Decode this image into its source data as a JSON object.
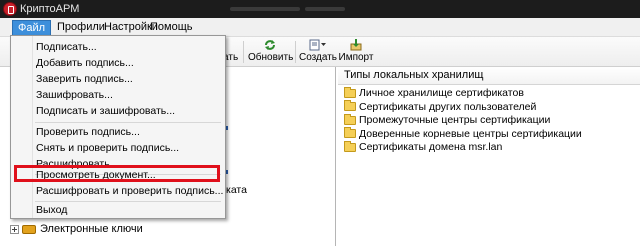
{
  "window": {
    "title": "КриптоАРМ"
  },
  "menubar": {
    "items": [
      {
        "label": "Файл",
        "active": true
      },
      {
        "label": "Профили",
        "active": false
      },
      {
        "label": "Настройки",
        "active": false
      },
      {
        "label": "Помощь",
        "active": false
      }
    ]
  },
  "toolbar": {
    "obscured_label_tail": "вать",
    "refresh_label": "Обновить",
    "create_label": "Создать",
    "import_label": "Импорт"
  },
  "tree": {
    "electronic_keys_label": "Электронные ключи",
    "obscured_tail": "ката"
  },
  "right_pane": {
    "column_header": "Типы локальных хранилищ",
    "stores": [
      {
        "label": "Личное хранилище сертификатов"
      },
      {
        "label": "Сертификаты других пользователей"
      },
      {
        "label": "Промежуточные центры сертификации"
      },
      {
        "label": "Доверенные корневые центры сертификации"
      },
      {
        "label": "Сертификаты домена msr.lan"
      }
    ]
  },
  "file_menu": {
    "items": [
      {
        "label": "Подписать..."
      },
      {
        "label": "Добавить подпись..."
      },
      {
        "label": "Заверить подпись..."
      },
      {
        "label": "Зашифровать..."
      },
      {
        "label": "Подписать и зашифровать..."
      },
      {
        "label": "Проверить подпись..."
      },
      {
        "label": "Снять и проверить подпись..."
      },
      {
        "label": "Расшифровать..."
      },
      {
        "label": "Просмотреть документ...",
        "highlighted": true
      },
      {
        "label": "Расшифровать и проверить подпись..."
      },
      {
        "label": "Выход"
      }
    ]
  },
  "colors": {
    "titlebar": "#1c1c1c",
    "menu_active": "#3d8fdb",
    "highlight_border": "#e0101b",
    "folder": "#f5cf57"
  },
  "icons": {
    "app": "cryptoarm-app-icon",
    "refresh": "refresh-icon",
    "create": "create-icon",
    "import": "import-icon",
    "folder": "folder-icon",
    "key": "key-icon"
  }
}
